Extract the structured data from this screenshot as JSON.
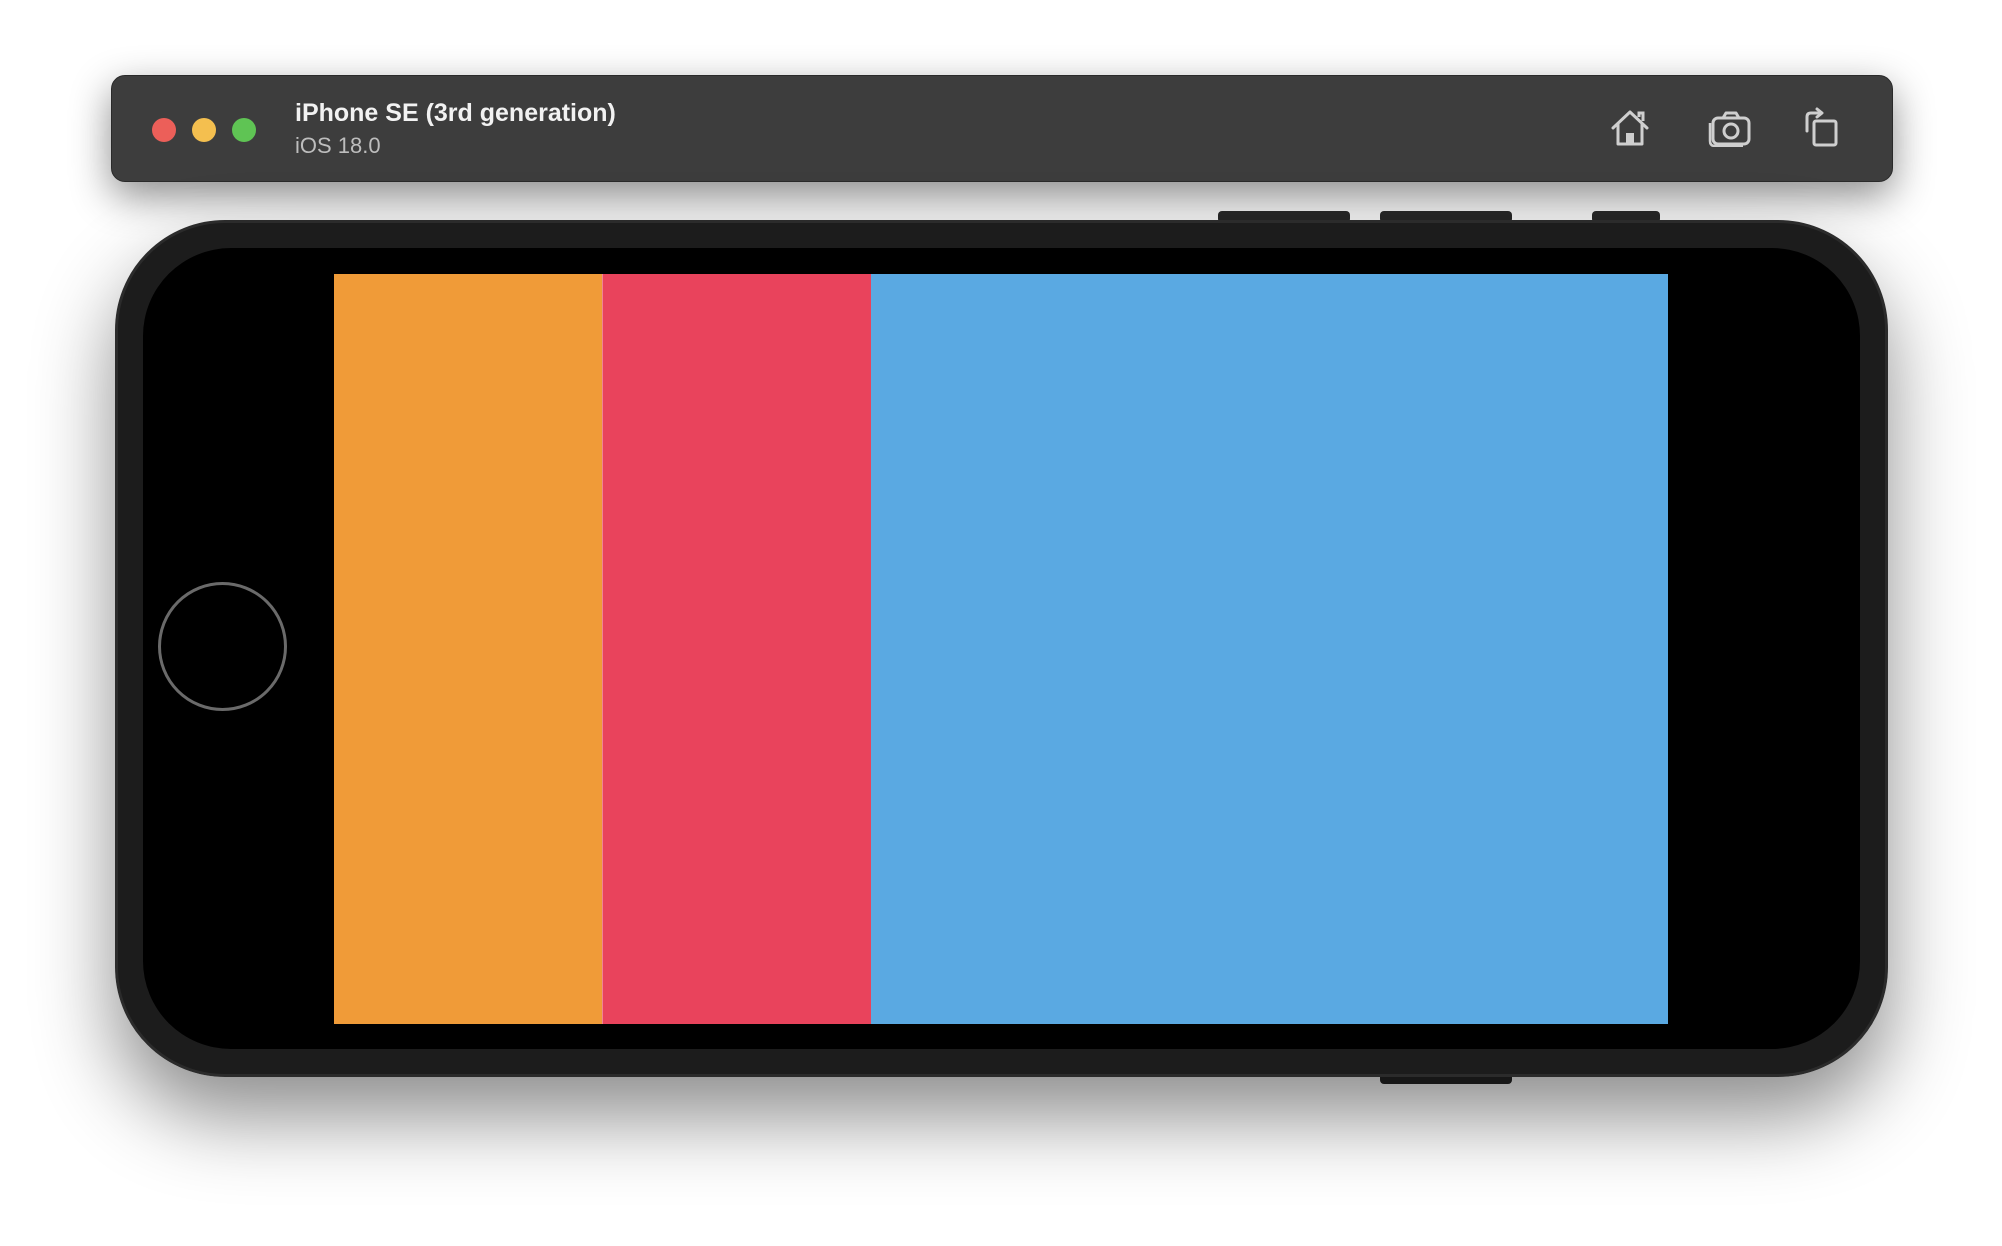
{
  "window": {
    "device_name": "iPhone SE (3rd generation)",
    "os_version": "iOS 18.0",
    "traffic_lights": {
      "close_color": "#ec5f59",
      "minimize_color": "#f4bf4f",
      "zoom_color": "#5fc454"
    },
    "toolbar_buttons": [
      {
        "icon": "home-icon",
        "action": "Home"
      },
      {
        "icon": "camera-icon",
        "action": "Screenshot"
      },
      {
        "icon": "rotate-icon",
        "action": "Rotate"
      }
    ]
  },
  "screen": {
    "panels": [
      {
        "color": "#f09b38"
      },
      {
        "color": "#e9435c"
      },
      {
        "color": "#5aa9e2"
      }
    ]
  }
}
